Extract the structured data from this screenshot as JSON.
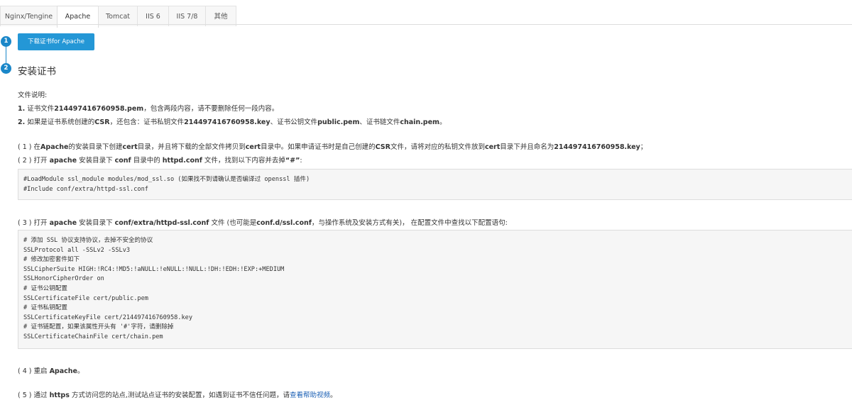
{
  "tabs": [
    "Nginx/Tengine",
    "Apache",
    "Tomcat",
    "IIS 6",
    "IIS 7/8",
    "其他"
  ],
  "active_tab": "Apache",
  "steps": {
    "one": "1",
    "two": "2"
  },
  "download_button": "下载证书for Apache",
  "section_title": "安装证书",
  "file_desc": {
    "heading": "文件说明:",
    "item1_num": "1.",
    "item1_pre": "证书文件",
    "item1_file": "214497416760958.pem",
    "item1_post": "，包含两段内容，请不要删除任何一段内容。",
    "item2_num": "2.",
    "item2_pre": "如果是证书系统创建的",
    "item2_csr": "CSR",
    "item2_mid1": "，还包含：证书私钥文件",
    "item2_key": "214497416760958.key",
    "item2_mid2": "、证书公钥文件",
    "item2_pub": "public.pem",
    "item2_mid3": "、证书链文件",
    "item2_chain": "chain.pem",
    "item2_post": "。"
  },
  "step1": {
    "num": "( 1 )",
    "a": "在",
    "apache": "Apache",
    "b": "的安装目录下创建",
    "cert1": "cert",
    "c": "目录，并且将下载的全部文件拷贝到",
    "cert2": "cert",
    "d": "目录中。如果申请证书时是自己创建的",
    "csr": "CSR",
    "e": "文件，请将对应的私钥文件放到",
    "cert3": "cert",
    "f": "目录下并且命名为",
    "keyfile": "214497416760958.key",
    "g": "；"
  },
  "step2": {
    "num": "( 2 )",
    "a": "打开",
    "apache": "apache",
    "b": "安装目录下",
    "conf": "conf",
    "c": "目录中的",
    "httpd": "httpd.conf",
    "d": "文件，找到以下内容并去掉",
    "hash": "“#”",
    "e": ":"
  },
  "code1": [
    "#LoadModule ssl_module modules/mod_ssl.so (如果找不到请确认是否编译过 openssl 插件)",
    "#Include conf/extra/httpd-ssl.conf"
  ],
  "step3": {
    "num": "( 3 )",
    "a": "打开",
    "apache": "apache",
    "b": "安装目录下",
    "path": "conf/extra/httpd-ssl.conf",
    "c": "文件 (也可能是",
    "alt": "conf.d/ssl.conf",
    "d": "，与操作系统及安装方式有关)， 在配置文件中查找以下配置语句:"
  },
  "code2": [
    "# 添加 SSL 协议支持协议，去掉不安全的协议",
    "SSLProtocol all -SSLv2 -SSLv3",
    "# 修改加密套件如下",
    "SSLCipherSuite HIGH:!RC4:!MD5:!aNULL:!eNULL:!NULL:!DH:!EDH:!EXP:+MEDIUM",
    "SSLHonorCipherOrder on",
    "# 证书公钥配置",
    "SSLCertificateFile cert/public.pem",
    "# 证书私钥配置",
    "SSLCertificateKeyFile cert/214497416760958.key",
    "# 证书链配置，如果该属性开头有 '#'字符，请删除掉",
    "SSLCertificateChainFile cert/chain.pem"
  ],
  "step4": {
    "num": "( 4 )",
    "a": "重启",
    "apache": "Apache",
    "b": "。"
  },
  "step5": {
    "num": "( 5 )",
    "a": "通过",
    "https": "https",
    "b": "方式访问您的站点,测试站点证书的安装配置，如遇到证书不信任问题，请",
    "link": "查看帮助视频",
    "c": "。"
  },
  "colors": {
    "accent": "#1a87c9",
    "button": "#2497d6",
    "link": "#1a5fb4"
  }
}
